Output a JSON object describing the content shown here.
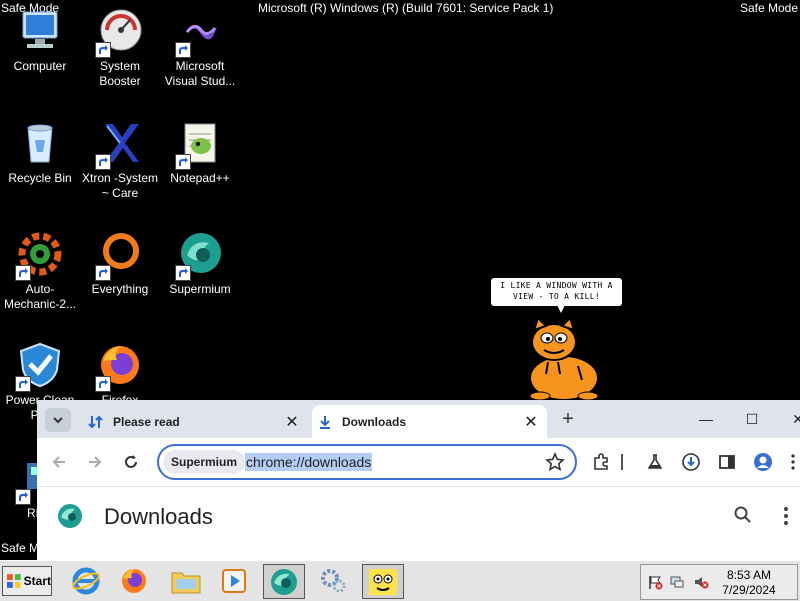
{
  "screen": {
    "safe_mode_top_left": "Safe Mode",
    "safe_mode_top_right": "Safe Mode",
    "safe_mode_bottom_left": "Safe Mode",
    "build_text": "Microsoft (R) Windows (R) (Build 7601: Service Pack 1)"
  },
  "desktop": {
    "icons": [
      {
        "label": "Computer"
      },
      {
        "label": "System Booster"
      },
      {
        "label": "Microsoft Visual Stud..."
      },
      {
        "label": "Recycle Bin"
      },
      {
        "label": "Xtron -System ~ Care"
      },
      {
        "label": "Notepad++"
      },
      {
        "label": "Auto-Mechanic-2..."
      },
      {
        "label": "Everything"
      },
      {
        "label": "Supermium"
      },
      {
        "label": "Power Clean Pro"
      },
      {
        "label": "Firefox"
      },
      {
        "label": "REG"
      }
    ],
    "cartoon_bubble": "I LIKE A WINDOW WITH A VIEW - TO A KILL!"
  },
  "browser": {
    "tabs": [
      {
        "label": "Please read",
        "active": false
      },
      {
        "label": "Downloads",
        "active": true
      }
    ],
    "omnibox_chip": "Supermium",
    "omnibox_url": "chrome://downloads",
    "page_title": "Downloads"
  },
  "taskbar": {
    "start_label": "Start",
    "clock_time": "8:53 AM",
    "clock_date": "7/29/2024"
  },
  "colors": {
    "desktop_bg": "#000000",
    "accent": "#3b6fd4",
    "tabstrip": "#dfe3eb",
    "taskbar": "#e4e4e4"
  }
}
